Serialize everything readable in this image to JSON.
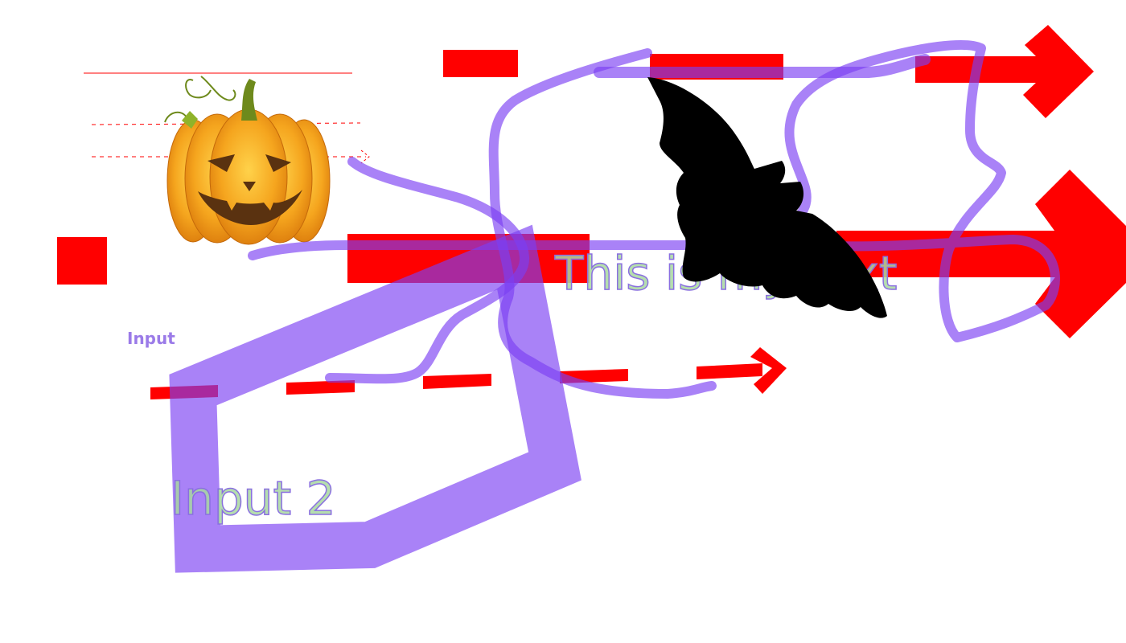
{
  "canvas": {
    "texts": {
      "input_label": "Input",
      "input2_label": "Input 2",
      "my_text": "This is my text"
    },
    "images": {
      "pumpkin": "jack-o-lantern-icon",
      "bat": "bat-icon"
    },
    "colors": {
      "background": "#ffffff",
      "red": "#ff0000",
      "purple": "#7b3ff2",
      "purple_text": "#9b7be8",
      "outlined_text_fill": "#a8d8a0",
      "outlined_text_stroke": "#8a6fe0",
      "bat": "#000000",
      "pumpkin_orange": "#f39a1a",
      "pumpkin_stem": "#6e8a1c"
    }
  }
}
